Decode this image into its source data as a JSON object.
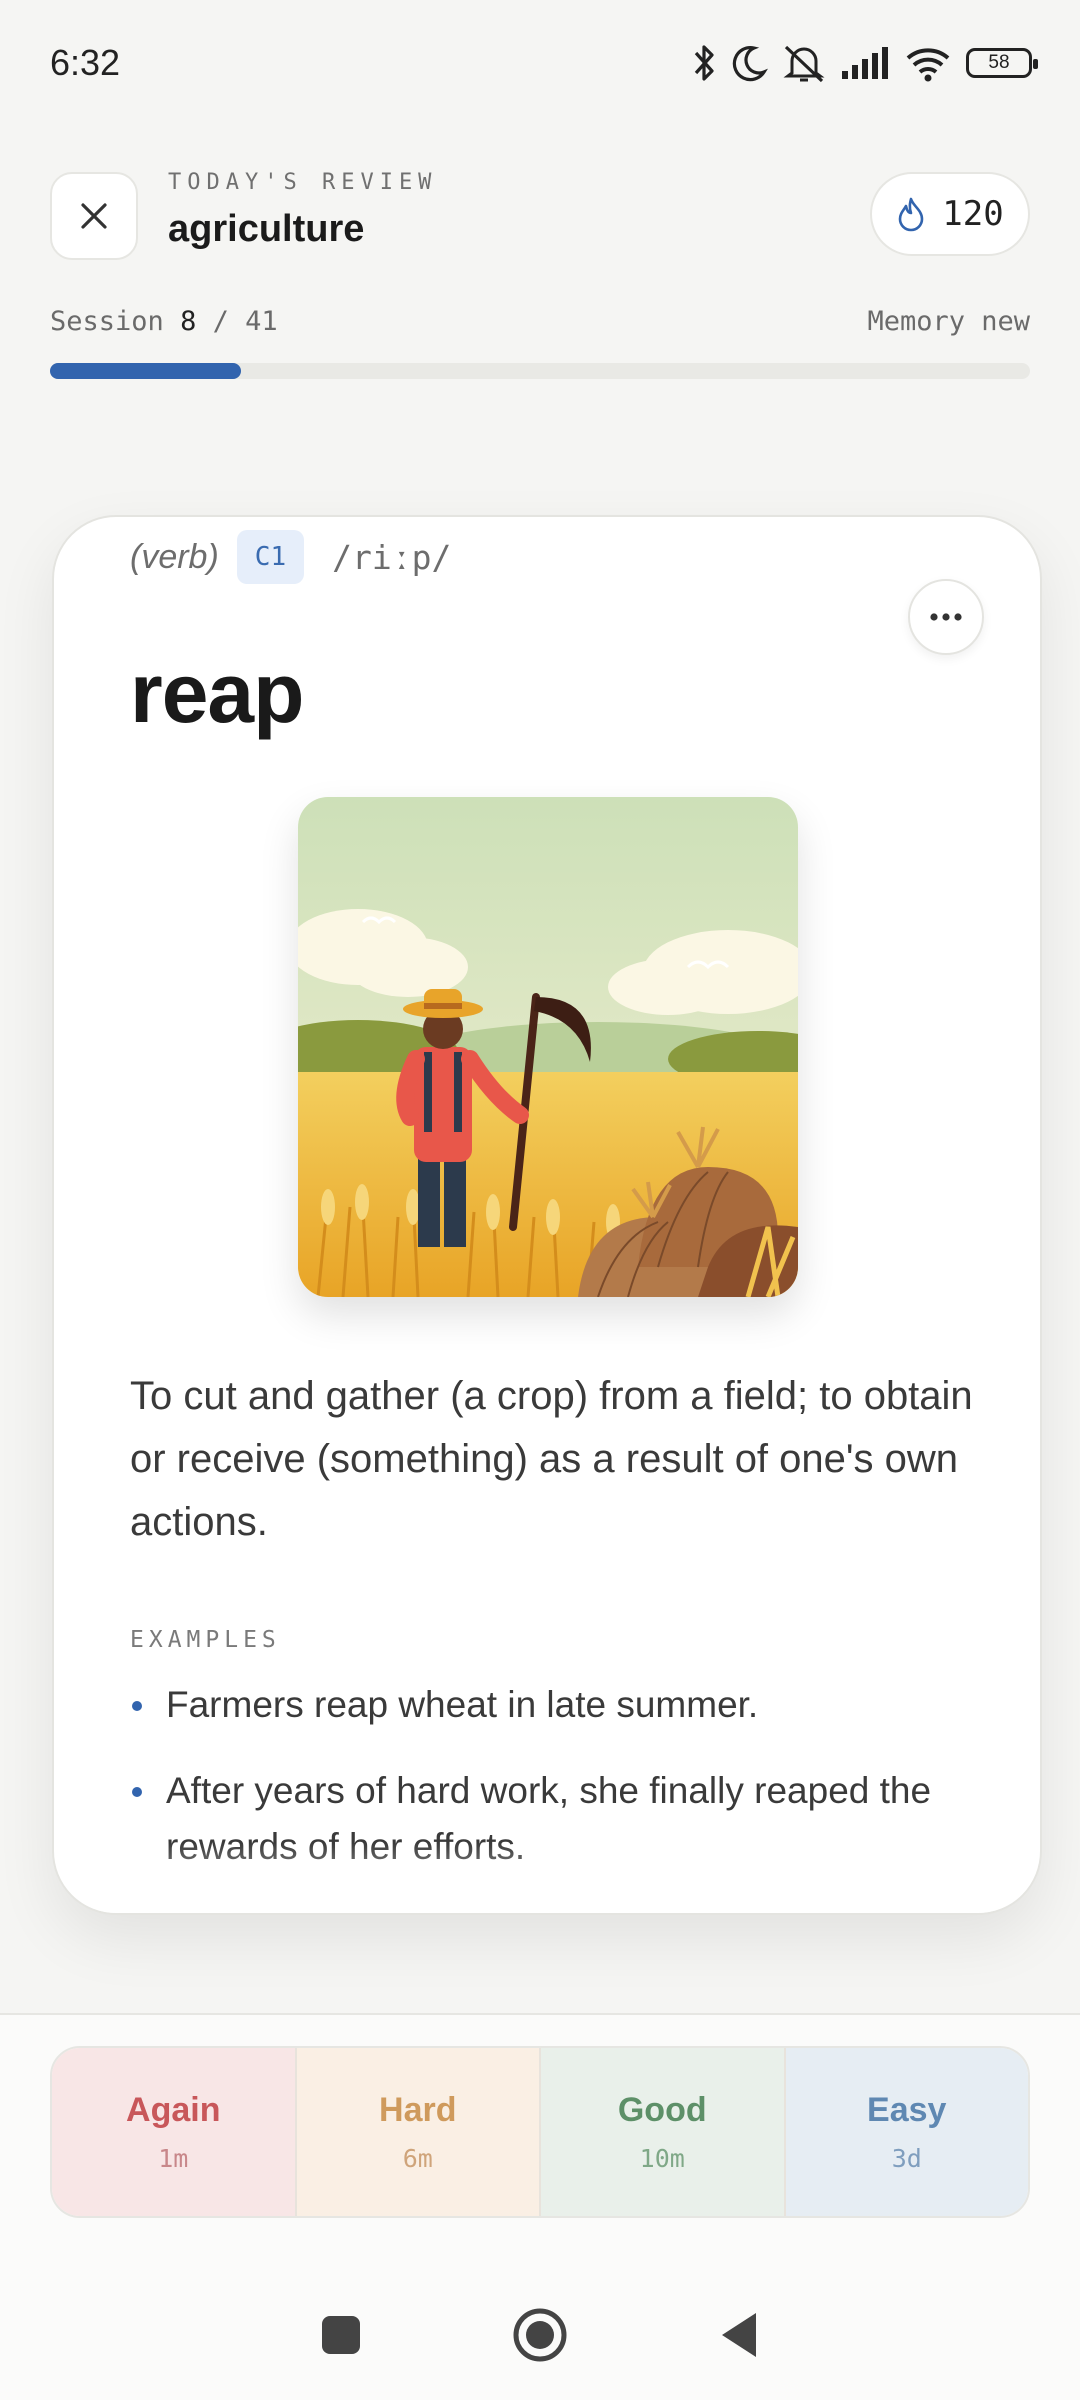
{
  "status_bar": {
    "time": "6:32",
    "battery": "58",
    "icons": [
      "bluetooth-icon",
      "moon-icon",
      "mute-icon",
      "signal-icon",
      "wifi-icon",
      "battery-icon"
    ]
  },
  "header": {
    "kicker": "TODAY'S REVIEW",
    "title": "agriculture",
    "streak_count": "120",
    "close_icon": "close-icon",
    "streak_icon": "flame-icon"
  },
  "session": {
    "label": "Session",
    "current": "8",
    "separator": "/",
    "total": "41",
    "memory_label": "Memory new",
    "progress": 0.195
  },
  "card": {
    "part_of_speech": "(verb)",
    "level": "C1",
    "ipa": "/riːp/",
    "headword": "reap",
    "more_icon": "more-icon",
    "definition": "To cut and gather (a crop) from a field; to obtain or receive (something) as a result of one's own actions.",
    "examples_label": "EXAMPLES",
    "examples": [
      "Farmers reap wheat in late summer.",
      "After years of hard work, she finally reaped the rewards of her efforts."
    ]
  },
  "grades": [
    {
      "label": "Again",
      "interval": "1m",
      "bg": "#f8e6e6",
      "color": "#c8575a",
      "sub": "#c8878a"
    },
    {
      "label": "Hard",
      "interval": "6m",
      "bg": "#faefe4",
      "color": "#cf9a5c",
      "sub": "#cfa47a"
    },
    {
      "label": "Good",
      "interval": "10m",
      "bg": "#e9f0ea",
      "color": "#5d9068",
      "sub": "#7fa887"
    },
    {
      "label": "Easy",
      "interval": "3d",
      "bg": "#e6edf3",
      "color": "#5f88b2",
      "sub": "#7f9ebe"
    }
  ],
  "colors": {
    "accent": "#3264ae",
    "background": "#f5f5f3"
  }
}
